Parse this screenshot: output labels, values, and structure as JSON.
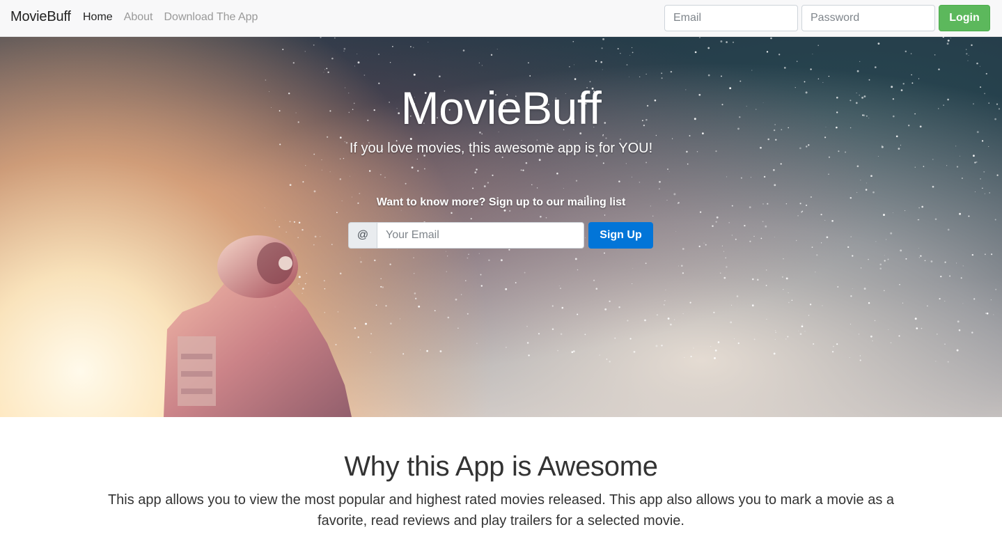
{
  "navbar": {
    "brand": "MovieBuff",
    "links": [
      {
        "label": "Home",
        "active": true
      },
      {
        "label": "About",
        "active": false
      },
      {
        "label": "Download The App",
        "active": false
      }
    ],
    "email_placeholder": "Email",
    "password_placeholder": "Password",
    "login_label": "Login"
  },
  "hero": {
    "title": "MovieBuff",
    "subtitle": "If you love movies, this awesome app is for YOU!",
    "mailing_label": "Want to know more? Sign up to our mailing list",
    "at_symbol": "@",
    "email_placeholder": "Your Email",
    "signup_label": "Sign Up"
  },
  "why": {
    "title": "Why this App is Awesome",
    "text": "This app allows you to view the most popular and highest rated movies released. This app also allows you to mark a movie as a favorite, read reviews and play trailers for a selected movie."
  },
  "colors": {
    "login_button": "#5cb85c",
    "signup_button": "#0275d8",
    "navbar_bg": "#f8f8f9"
  }
}
